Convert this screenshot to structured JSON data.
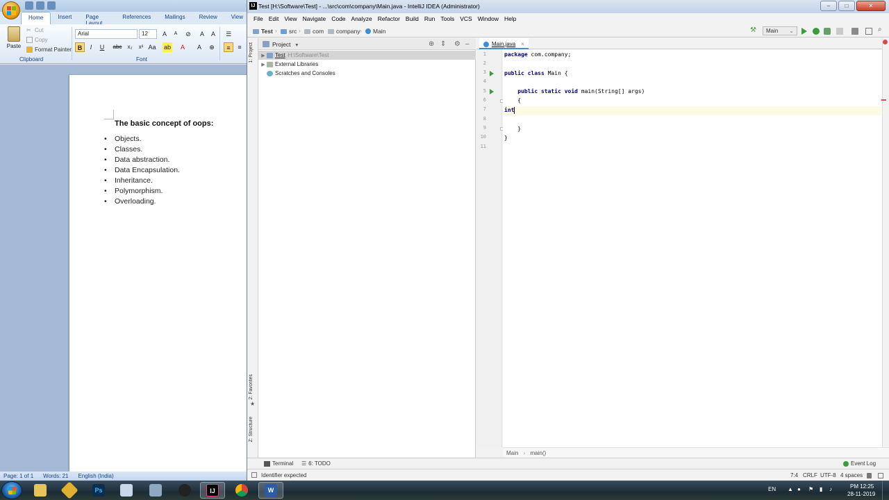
{
  "word": {
    "tabs": [
      "Home",
      "Insert",
      "Page Layout",
      "References",
      "Mailings",
      "Review",
      "View"
    ],
    "clipboard": {
      "paste_label": "Paste",
      "cut_label": "Cut",
      "copy_label": "Copy",
      "format_painter_label": "Format Painter",
      "group_label": "Clipboard"
    },
    "font": {
      "name": "Arial",
      "size": "12",
      "group_label": "Font"
    },
    "document": {
      "heading": "The basic concept of oops:",
      "items": [
        "Objects.",
        "Classes.",
        "Data abstraction.",
        "Data Encapsulation.",
        "Inheritance.",
        "Polymorphism.",
        "Overloading."
      ]
    },
    "status": {
      "page": "Page: 1 of 1",
      "words": "Words: 21",
      "language": "English (India)"
    }
  },
  "intellij": {
    "title": "Test [H:\\Software\\Test] - ...\\src\\com\\company\\Main.java - IntelliJ IDEA (Administrator)",
    "menu": [
      "File",
      "Edit",
      "View",
      "Navigate",
      "Code",
      "Analyze",
      "Refactor",
      "Build",
      "Run",
      "Tools",
      "VCS",
      "Window",
      "Help"
    ],
    "breadcrumbs": [
      "Test",
      "src",
      "com",
      "company",
      "Main"
    ],
    "run_config": "Main",
    "side_tabs": {
      "project": "1: Project",
      "favorites": "2: Favorites",
      "structure": "Z: Structure"
    },
    "project_panel": {
      "title": "Project",
      "tree": [
        {
          "label": "Test",
          "hint": "H:\\Software\\Test"
        },
        {
          "label": "External Libraries",
          "hint": ""
        },
        {
          "label": "Scratches and Consoles",
          "hint": ""
        }
      ]
    },
    "editor": {
      "tab": "Main.java",
      "line_numbers": [
        "1",
        "2",
        "3",
        "4",
        "5",
        "6",
        "7",
        "8",
        "9",
        "10",
        "11"
      ],
      "lines": [
        {
          "kw": "package",
          "rest": " com.company;"
        },
        {
          "kw": "",
          "rest": ""
        },
        {
          "kw": "public class",
          "rest": " Main {"
        },
        {
          "kw": "",
          "rest": ""
        },
        {
          "kw": "    public static void",
          "rest": " main(String[] args)"
        },
        {
          "kw": "",
          "rest": "    {"
        },
        {
          "kw": "int",
          "rest": ""
        },
        {
          "kw": "",
          "rest": ""
        },
        {
          "kw": "",
          "rest": "    }"
        },
        {
          "kw": "",
          "rest": "}"
        },
        {
          "kw": "",
          "rest": ""
        }
      ],
      "crumb_class": "Main",
      "crumb_method": "main()"
    },
    "tool_windows": {
      "terminal": "Terminal",
      "todo": "6: TODO",
      "event_log": "Event Log"
    },
    "status": {
      "message": "Identifier expected",
      "position": "7:4",
      "line_sep": "CRLF",
      "encoding": "UTF-8",
      "indent": "4 spaces"
    }
  },
  "taskbar": {
    "lang": "EN",
    "time": "PM 12:25",
    "date": "28-11-2019"
  }
}
